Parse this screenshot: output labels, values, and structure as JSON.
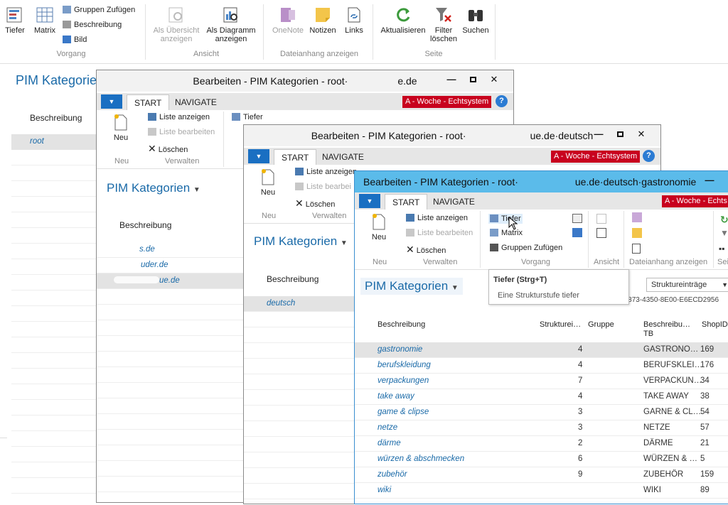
{
  "main_ribbon": {
    "tiefer": "Tiefer",
    "matrix": "Matrix",
    "gruppen_zufuegen": "Gruppen Zufügen",
    "beschreibung": "Beschreibung",
    "bild": "Bild",
    "vorgang": "Vorgang",
    "als_uebersicht_1": "Als Übersicht",
    "als_uebersicht_2": "anzeigen",
    "als_diagramm_1": "Als Diagramm",
    "als_diagramm_2": "anzeigen",
    "ansicht": "Ansicht",
    "onenote": "OneNote",
    "notizen": "Notizen",
    "links": "Links",
    "dateianhang": "Dateianhang anzeigen",
    "aktualisieren": "Aktualisieren",
    "filter_1": "Filter",
    "filter_2": "löschen",
    "suchen": "Suchen",
    "seite": "Seite"
  },
  "background_page": {
    "title": "PIM Kategorien",
    "col_beschreibung": "Beschreibung",
    "rows": [
      "root"
    ]
  },
  "win1": {
    "title_prefix": "Bearbeiten - PIM Kategorien - root·",
    "title_suffix": "e.de",
    "tab_start": "START",
    "tab_navigate": "NAVIGATE",
    "env": "A - Woche - Echtsystem",
    "neu": "Neu",
    "grp_neu": "Neu",
    "liste_anzeigen": "Liste anzeigen",
    "liste_bearbeiten": "Liste bearbeiten",
    "loeschen": "Löschen",
    "grp_verwalten": "Verwalten",
    "tiefer": "Tiefer",
    "page_title": "PIM Kategorien",
    "col_beschreibung": "Beschreibung",
    "rows": [
      "s.de",
      "uder.de",
      "ue.de"
    ]
  },
  "win2": {
    "title_prefix": "Bearbeiten - PIM Kategorien - root·",
    "title_suffix": "ue.de·deutsch",
    "tab_start": "START",
    "tab_navigate": "NAVIGATE",
    "env": "A - Woche - Echtsystem",
    "neu": "Neu",
    "grp_neu": "Neu",
    "liste_anzeigen": "Liste anzeigen",
    "liste_bearbeiten": "Liste bearbei",
    "loeschen": "Löschen",
    "grp_verwalten": "Verwalten",
    "page_title": "PIM Kategorien",
    "col_beschreibung": "Beschreibung",
    "rows": [
      "deutsch"
    ]
  },
  "win3": {
    "title_prefix": "Bearbeiten - PIM Kategorien - root·",
    "title_suffix": "ue.de·deutsch·gastronomie",
    "tab_start": "START",
    "tab_navigate": "NAVIGATE",
    "env": "A - Woche - Echts",
    "neu": "Neu",
    "grp_neu": "Neu",
    "liste_anzeigen": "Liste anzeigen",
    "liste_bearbeiten": "Liste bearbeiten",
    "loeschen": "Löschen",
    "grp_verwalten": "Verwalten",
    "tiefer": "Tiefer",
    "matrix": "Matrix",
    "gruppen_zufuegen": "Gruppen Zufügen",
    "grp_vorgang": "Vorgang",
    "grp_ansicht": "Ansicht",
    "grp_dateianhang": "Dateianhang anzeigen",
    "grp_seite": "Seit",
    "page_title": "PIM Kategorien",
    "filter_select": "Struktureinträge",
    "filter_text": "Filter: {…C52945-E873-4350-8E00-E6ECD2956",
    "tooltip_title": "Tiefer (Strg+T)",
    "tooltip_desc": "Eine Strukturstufe tiefer",
    "columns": {
      "beschreibung": "Beschreibung",
      "struktur": "Strukturei…",
      "gruppe": "Gruppe",
      "beschreibung_tb_1": "Beschreibu…",
      "beschreibung_tb_2": "TB",
      "shopid": "ShopID"
    },
    "rows": [
      {
        "name": "gastronomie",
        "struktur": "4",
        "tb": "GASTRONO…",
        "shop": "169"
      },
      {
        "name": "berufskleidung",
        "struktur": "4",
        "tb": "BERUFSKLEI…",
        "shop": "176"
      },
      {
        "name": "verpackungen",
        "struktur": "7",
        "tb": "VERPACKUN…",
        "shop": "34"
      },
      {
        "name": "take away",
        "struktur": "4",
        "tb": "TAKE AWAY",
        "shop": "38"
      },
      {
        "name": "game & clipse",
        "struktur": "3",
        "tb": "GARNE & CL…",
        "shop": "54"
      },
      {
        "name": "netze",
        "struktur": "3",
        "tb": "NETZE",
        "shop": "57"
      },
      {
        "name": "därme",
        "struktur": "2",
        "tb": "DÄRME",
        "shop": "21"
      },
      {
        "name": "würzen & abschmecken",
        "struktur": "6",
        "tb": "WÜRZEN & …",
        "shop": "5"
      },
      {
        "name": "zubehör",
        "struktur": "9",
        "tb": "ZUBEHÖR",
        "shop": "159"
      },
      {
        "name": "wiki",
        "struktur": "",
        "tb": "WIKI",
        "shop": "89"
      }
    ]
  }
}
